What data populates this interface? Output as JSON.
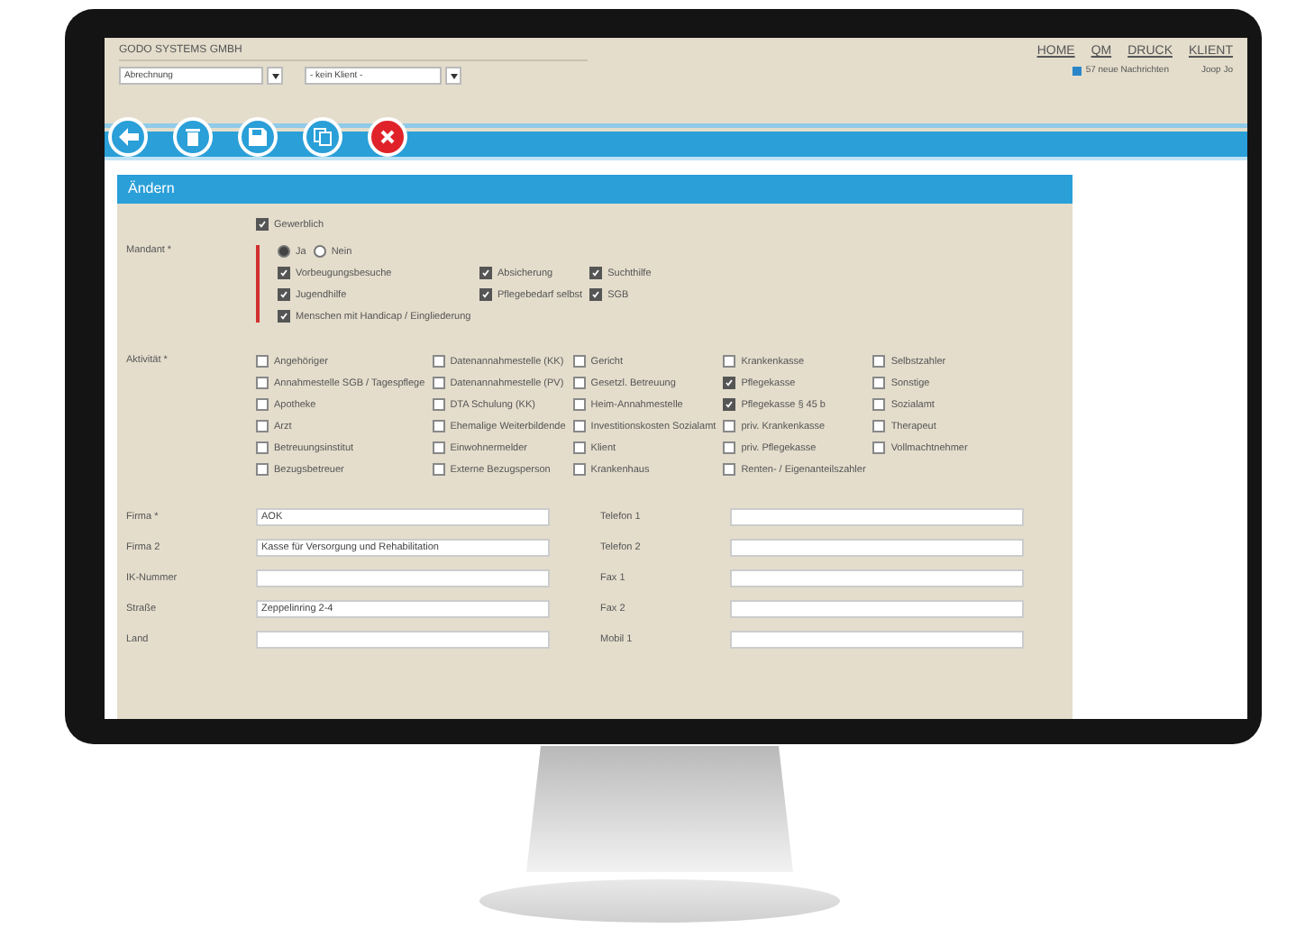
{
  "header": {
    "company": "GODO SYSTEMS GMBH",
    "selects": [
      "Abrechnung",
      "- kein Klient -"
    ],
    "nav": [
      "HOME",
      "QM",
      "DRUCK",
      "KLIENT"
    ],
    "messages": "57 neue Nachrichten",
    "user": "Joop Jo"
  },
  "toolbar": [
    {
      "kind": "back"
    },
    {
      "kind": "delete"
    },
    {
      "kind": "save"
    },
    {
      "kind": "copy"
    },
    {
      "kind": "close"
    }
  ],
  "panel": {
    "title": "Ändern",
    "gewerblich": {
      "label": "Gewerblich",
      "checked": true
    },
    "mandant": {
      "label": "Mandant *",
      "radios": [
        {
          "label": "Ja",
          "selected": true
        },
        {
          "label": "Nein",
          "selected": false
        }
      ],
      "options": [
        {
          "label": "Vorbeugungsbesuche",
          "checked": true
        },
        {
          "label": "Absicherung",
          "checked": true
        },
        {
          "label": "Suchthilfe",
          "checked": true
        },
        {
          "label": "Jugendhilfe",
          "checked": true
        },
        {
          "label": "Pflegebedarf selbst",
          "checked": true
        },
        {
          "label": "SGB",
          "checked": true
        },
        {
          "label": "Menschen mit Handicap / Eingliederung",
          "checked": true
        }
      ]
    },
    "aktivitaet": {
      "label": "Aktivität *",
      "columns": [
        [
          {
            "label": "Angehöriger",
            "checked": false
          },
          {
            "label": "Annahmestelle SGB / Tagespflege",
            "checked": false
          },
          {
            "label": "Apotheke",
            "checked": false
          },
          {
            "label": "Arzt",
            "checked": false
          },
          {
            "label": "Betreuungsinstitut",
            "checked": false
          },
          {
            "label": "Bezugsbetreuer",
            "checked": false
          }
        ],
        [
          {
            "label": "Datenannahmestelle (KK)",
            "checked": false
          },
          {
            "label": "Datenannahmestelle (PV)",
            "checked": false
          },
          {
            "label": "DTA Schulung (KK)",
            "checked": false
          },
          {
            "label": "Ehemalige Weiterbildende",
            "checked": false
          },
          {
            "label": "Einwohnermelder",
            "checked": false
          },
          {
            "label": "Externe Bezugsperson",
            "checked": false
          }
        ],
        [
          {
            "label": "Gericht",
            "checked": false
          },
          {
            "label": "Gesetzl. Betreuung",
            "checked": false
          },
          {
            "label": "Heim-Annahmestelle",
            "checked": false
          },
          {
            "label": "Investitionskosten Sozialamt",
            "checked": false
          },
          {
            "label": "Klient",
            "checked": false
          },
          {
            "label": "Krankenhaus",
            "checked": false
          }
        ],
        [
          {
            "label": "Krankenkasse",
            "checked": false
          },
          {
            "label": "Pflegekasse",
            "checked": true
          },
          {
            "label": "Pflegekasse § 45 b",
            "checked": true
          },
          {
            "label": "priv. Krankenkasse",
            "checked": false
          },
          {
            "label": "priv. Pflegekasse",
            "checked": false
          },
          {
            "label": "Renten- / Eigenanteilszahler",
            "checked": false
          }
        ],
        [
          {
            "label": "Selbstzahler",
            "checked": false
          },
          {
            "label": "Sonstige",
            "checked": false
          },
          {
            "label": "Sozialamt",
            "checked": false
          },
          {
            "label": "Therapeut",
            "checked": false
          },
          {
            "label": "Vollmachtnehmer",
            "checked": false
          }
        ]
      ]
    },
    "fields": [
      {
        "left": {
          "label": "Firma *",
          "value": "AOK"
        },
        "right": {
          "label": "Telefon 1"
        }
      },
      {
        "left": {
          "label": "Firma 2",
          "value": "Kasse für Versorgung und Rehabilitation"
        },
        "right": {
          "label": "Telefon 2"
        }
      },
      {
        "left": {
          "label": "IK-Nummer"
        },
        "right": {
          "label": "Fax 1"
        }
      },
      {
        "left": {
          "label": "Straße",
          "value": "Zeppelinring 2-4"
        },
        "right": {
          "label": "Fax 2"
        }
      },
      {
        "left": {
          "label": "Land"
        },
        "right": {
          "label": "Mobil 1"
        }
      }
    ]
  }
}
